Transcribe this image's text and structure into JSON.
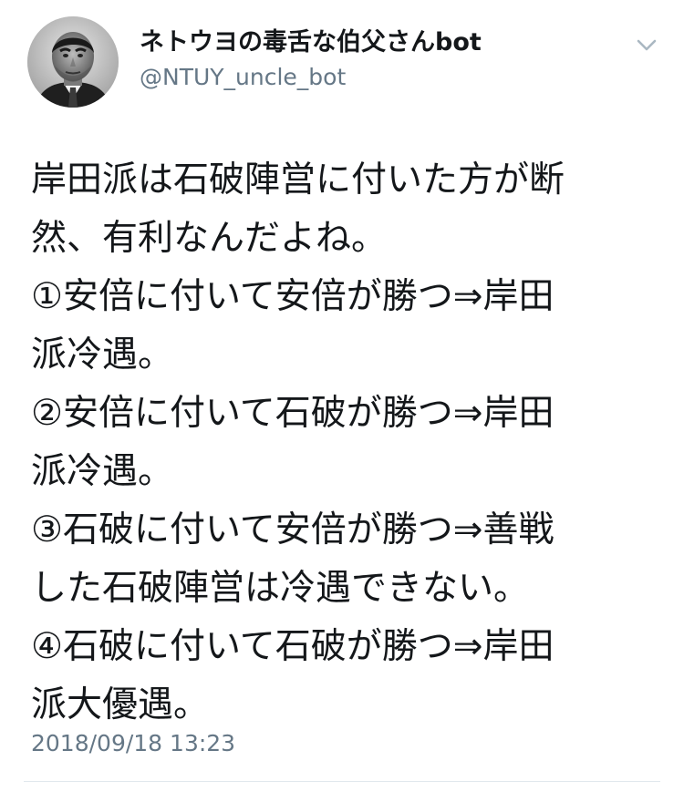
{
  "user": {
    "display_name": "ネトウヨの毒舌な伯父さんbot",
    "handle": "@NTUY_uncle_bot",
    "avatar_icon": "user-avatar-portrait"
  },
  "menu": {
    "icon": "chevron-down-icon"
  },
  "tweet": {
    "lines": [
      "岸田派は石破陣営に付いた方が断",
      "然、有利なんだよね。",
      "①安倍に付いて安倍が勝つ⇒岸田",
      "派冷遇。",
      "②安倍に付いて石破が勝つ⇒岸田",
      "派冷遇。",
      "③石破に付いて安倍が勝つ⇒善戦",
      "した石破陣営は冷遇できない。",
      "④石破に付いて石破が勝つ⇒岸田",
      "派大優遇。"
    ],
    "timestamp": "2018/09/18 13:23"
  },
  "colors": {
    "text": "#14171a",
    "secondary": "#657786",
    "divider": "#e1e8ed"
  }
}
